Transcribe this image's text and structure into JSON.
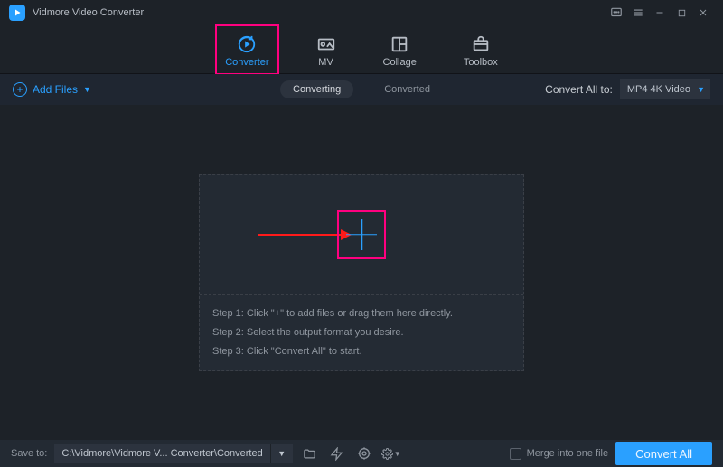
{
  "app": {
    "title": "Vidmore Video Converter"
  },
  "nav": {
    "converter": "Converter",
    "mv": "MV",
    "collage": "Collage",
    "toolbox": "Toolbox",
    "active": "converter"
  },
  "toolbar": {
    "add_files_label": "Add Files",
    "subtab_converting": "Converting",
    "subtab_converted": "Converted",
    "convert_all_to_label": "Convert All to:",
    "format_selected": "MP4 4K Video"
  },
  "dropzone": {
    "step1": "Step 1: Click \"+\" to add files or drag them here directly.",
    "step2": "Step 2: Select the output format you desire.",
    "step3": "Step 3: Click \"Convert All\" to start."
  },
  "footer": {
    "save_to_label": "Save to:",
    "path": "C:\\Vidmore\\Vidmore V... Converter\\Converted",
    "merge_label": "Merge into one file",
    "convert_button": "Convert All"
  }
}
